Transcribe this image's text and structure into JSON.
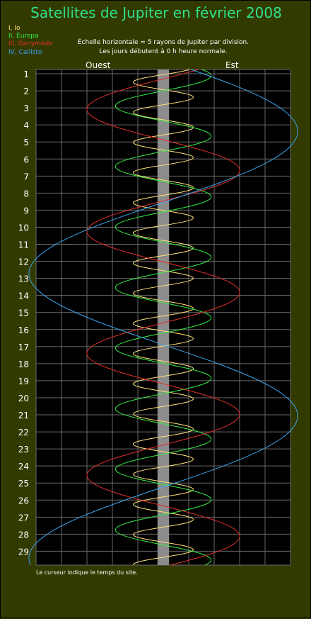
{
  "title": "Satellites de Jupiter en février 2008",
  "subtitle_line1": "Échelle horizontale = 5 rayons de Jupiter par division.",
  "subtitle_line2": "Les jours débutent à 0 h heure normale.",
  "west_label": "Ouest",
  "east_label": "Est",
  "footnote": "Le curseur indique le temps du site.",
  "colors": {
    "background": "#333a00",
    "plot_background": "#000000",
    "grid": "#6a6a6a",
    "jupiter": "#8c8c8c",
    "title": "#2ee08a"
  },
  "chart_data": {
    "type": "line",
    "title": "Satellites de Jupiter en février 2008",
    "xlabel": "",
    "ylabel": "",
    "x_unit_per_division": 5,
    "xlim": [
      -25,
      25
    ],
    "ylim": [
      1,
      29.6
    ],
    "y_ticks": [
      "1",
      "2",
      "3",
      "4",
      "5",
      "6",
      "7",
      "8",
      "9",
      "10",
      "11",
      "12",
      "13",
      "14",
      "15",
      "16",
      "17",
      "18",
      "19",
      "20",
      "21",
      "22",
      "23",
      "24",
      "25",
      "26",
      "27",
      "28",
      "29"
    ],
    "grid": true,
    "jupiter_radius": 1,
    "series": [
      {
        "name": "I, Io",
        "color": "#ffe27a",
        "amplitude": 5.9,
        "period_days": 1.769,
        "phase_day": 1.05,
        "direction": -1,
        "label_color": "#ffe27a"
      },
      {
        "name": "II, Europa",
        "color": "#33ee44",
        "amplitude": 9.4,
        "period_days": 3.551,
        "phase_day": 2.0,
        "direction": -1,
        "label_color": "#33ee44"
      },
      {
        "name": "III, Ganymède",
        "color": "#e0302a",
        "amplitude": 15.0,
        "period_days": 7.155,
        "phase_day": 1.3,
        "direction": -1,
        "label_color": "#e0302a"
      },
      {
        "name": "IV, Callisto",
        "color": "#3ba7f0",
        "amplitude": 26.4,
        "period_days": 16.689,
        "phase_day": 0.2,
        "direction": 1,
        "label_color": "#3ba7f0"
      }
    ]
  }
}
